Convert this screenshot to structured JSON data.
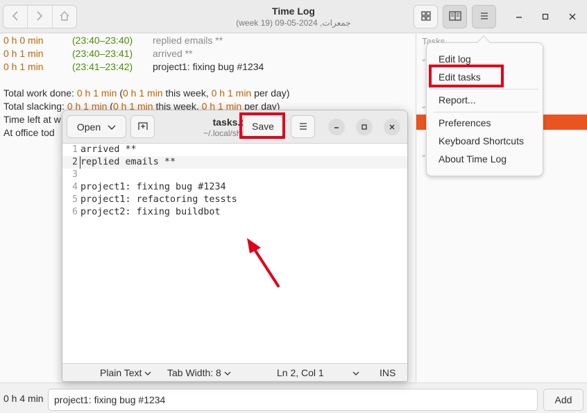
{
  "app": {
    "title": "Time Log",
    "subtitle": "(week 19) 09-05-2024 ,جمعرات"
  },
  "log": {
    "entries": [
      {
        "duration": "0 h 0 min",
        "range": "(23:40–23:40)",
        "task": "replied emails **"
      },
      {
        "duration": "0 h 1 min",
        "range": "(23:40–23:41)",
        "task": "arrived **"
      },
      {
        "duration": "0 h 1 min",
        "range": "(23:41–23:42)",
        "task": "project1: fixing bug #1234"
      }
    ],
    "summary": {
      "work_label": "Total work done: ",
      "work_value": "0 h 1 min",
      "work_week_open": " (",
      "work_week_value": "0 h 1 min",
      "work_week_label": " this week, ",
      "work_day_value": "0 h 1 min",
      "work_day_label": " per day)",
      "slack_label": "Total slacking: ",
      "slack_value": "0 h 1 min",
      "slack_week_open": " (",
      "slack_week_value": "0 h 1 min",
      "slack_week_label": " this week, ",
      "slack_day_value": "0 h 1 min",
      "slack_day_label": " per day)",
      "time_left_partial": "Time left at w",
      "office_partial": "At office tod"
    }
  },
  "side": {
    "header_partial": "Tasks"
  },
  "menu": {
    "items": [
      "Edit log",
      "Edit tasks",
      "Report...",
      "Preferences",
      "Keyboard Shortcuts",
      "About Time Log"
    ],
    "highlighted": "Edit tasks"
  },
  "editor": {
    "open_label": "Open",
    "title": "tasks.txt",
    "path": "~/.local/share…",
    "save_label": "Save",
    "lines": [
      {
        "n": "1",
        "text": "arrived **"
      },
      {
        "n": "2",
        "text": "replied emails **"
      },
      {
        "n": "3",
        "text": ""
      },
      {
        "n": "4",
        "text": "project1: fixing bug #1234"
      },
      {
        "n": "5",
        "text": "project1: refactoring tessts"
      },
      {
        "n": "6",
        "text": "project2: fixing buildbot"
      }
    ],
    "status": {
      "language": "Plain Text",
      "tab_width": "Tab Width: 8",
      "position": "Ln 2, Col 1",
      "mode": "INS"
    }
  },
  "bottom": {
    "total": "0 h 4 min",
    "entry_value": "project1: fixing bug #1234",
    "add_label": "Add"
  },
  "colors": {
    "accent": "#e95420",
    "duration": "#c26400",
    "range": "#4d8f00",
    "annotation": "#e0001b"
  }
}
